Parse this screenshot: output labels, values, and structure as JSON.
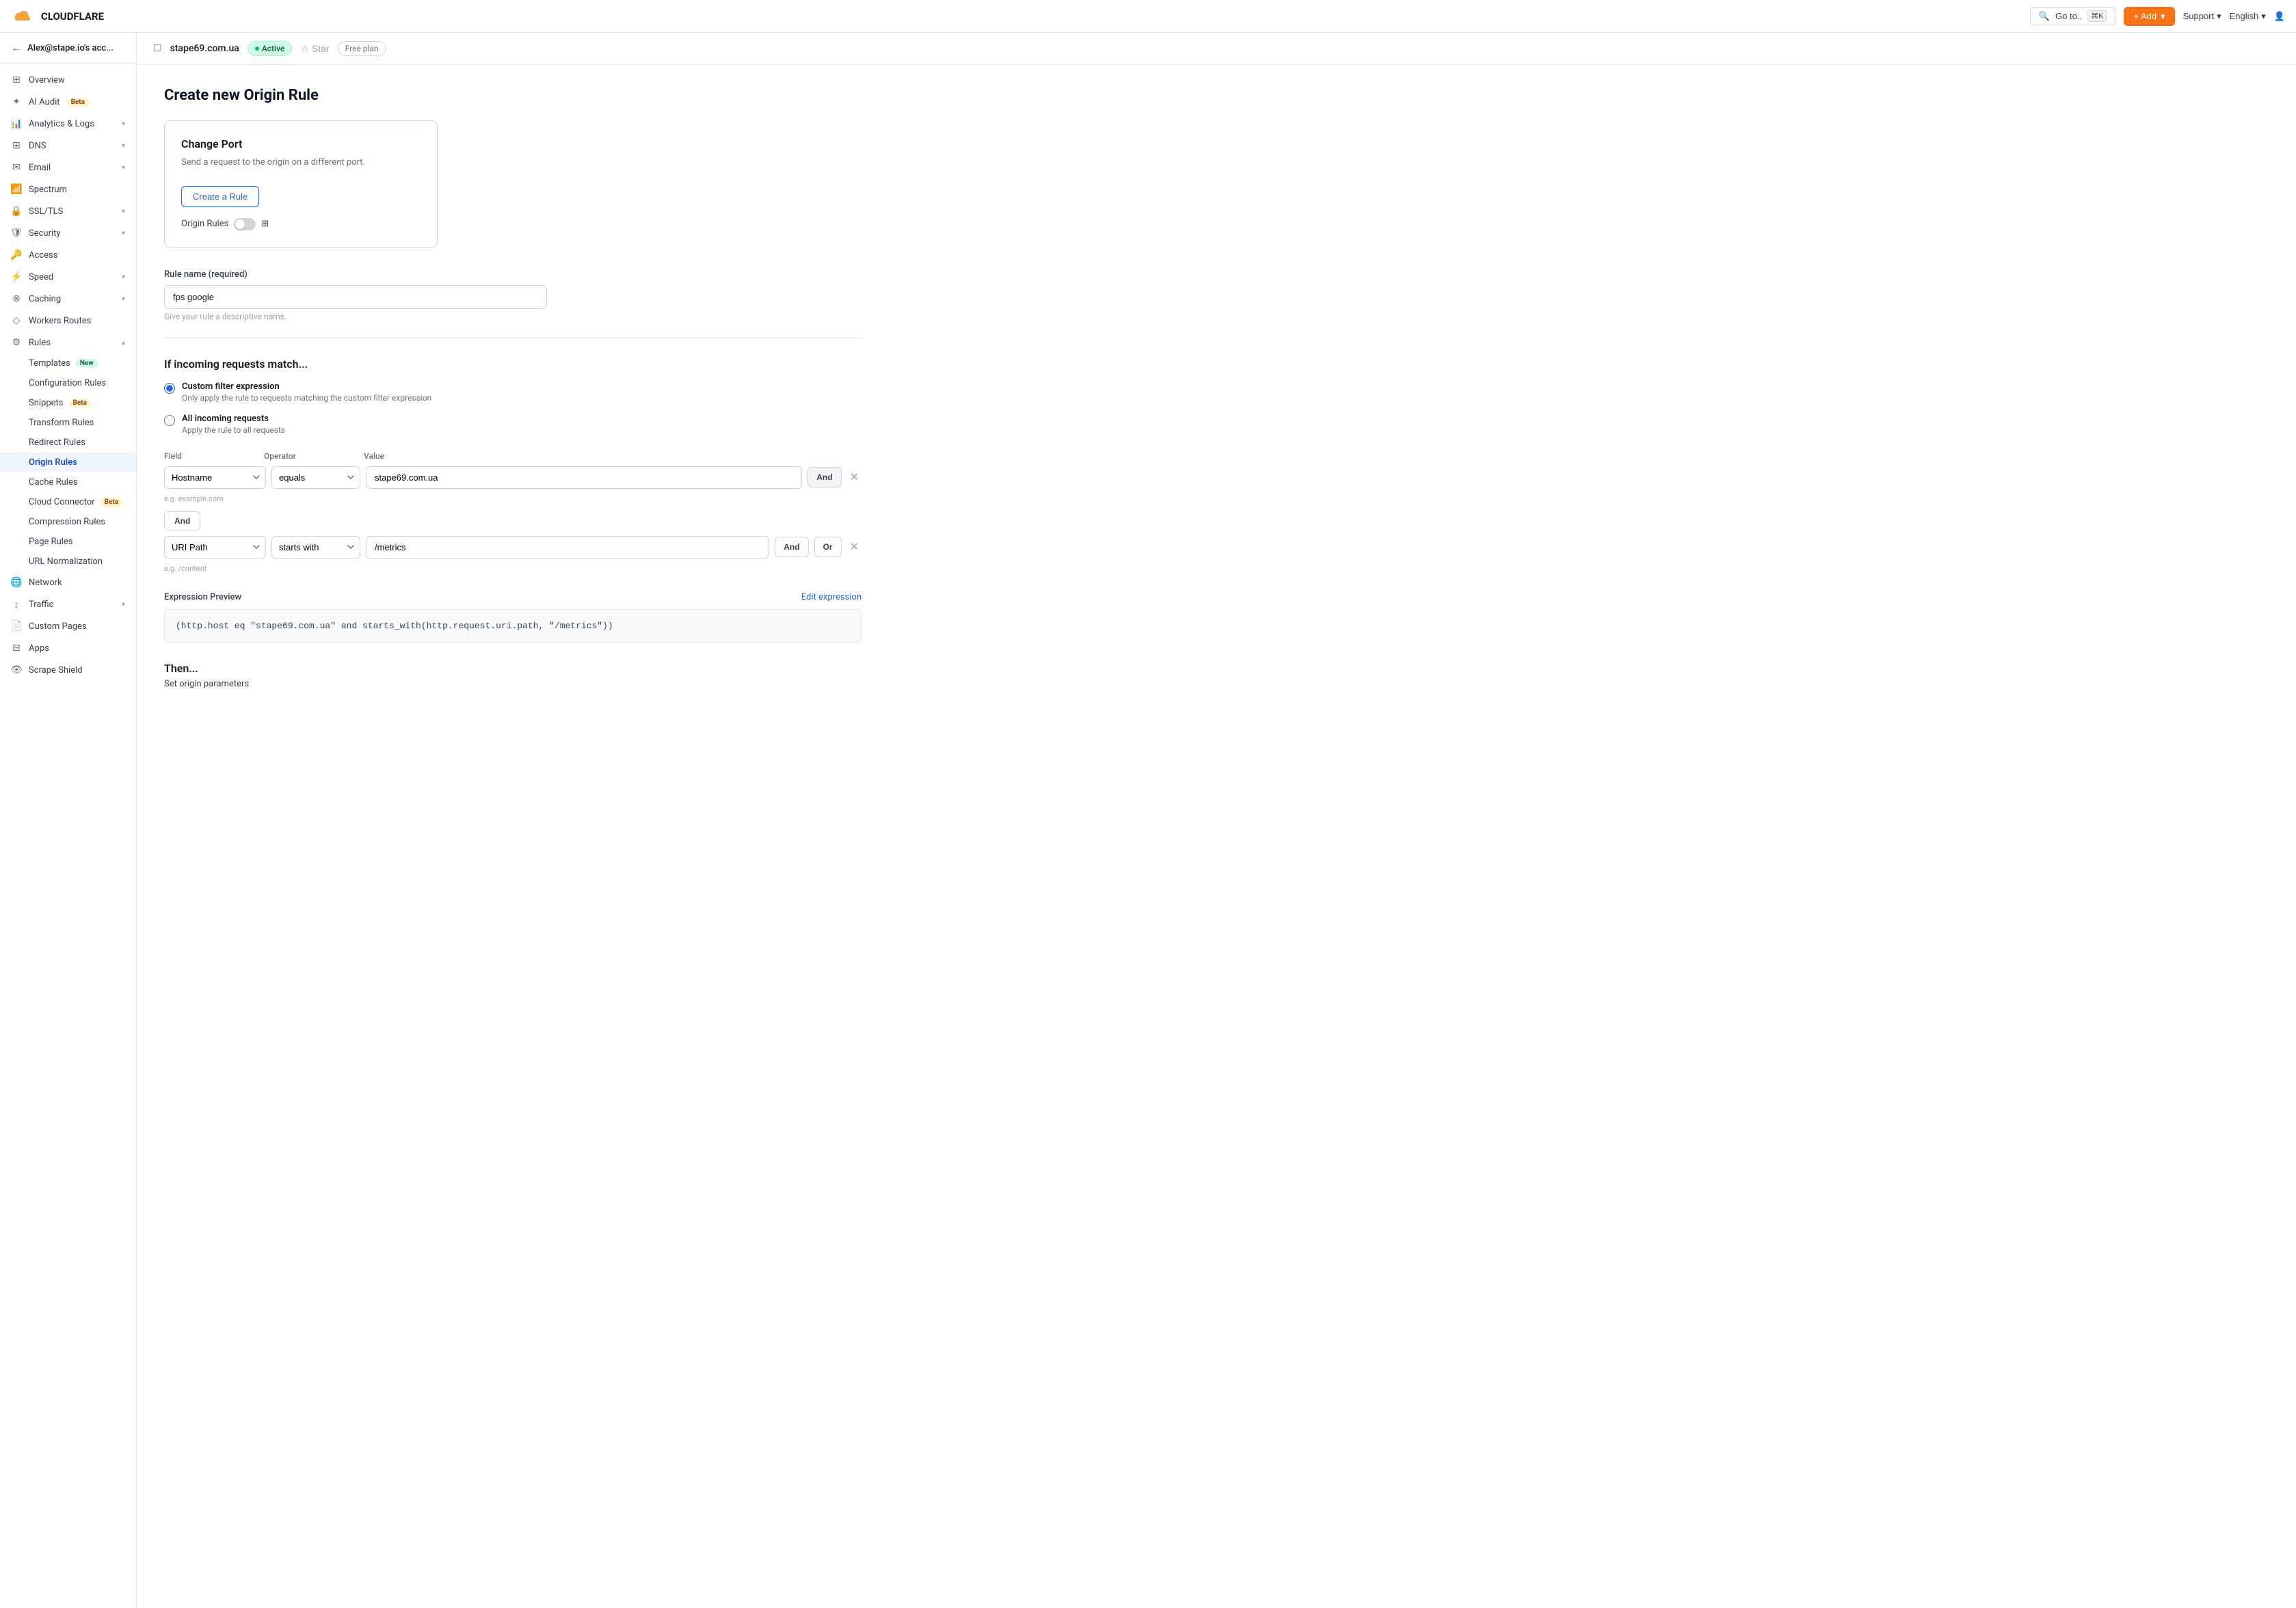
{
  "topnav": {
    "goto_label": "Go to..",
    "kbd_shortcut": "⌘K",
    "add_label": "+ Add",
    "support_label": "Support",
    "language_label": "English"
  },
  "sidebar": {
    "account": "Alex@stape.io's acc...",
    "nav_items": [
      {
        "id": "overview",
        "label": "Overview",
        "icon": "grid"
      },
      {
        "id": "ai-audit",
        "label": "AI Audit",
        "icon": "sparkle",
        "badge": "Beta",
        "badge_type": "beta"
      },
      {
        "id": "analytics-logs",
        "label": "Analytics & Logs",
        "icon": "bar-chart",
        "has_chevron": true
      },
      {
        "id": "dns",
        "label": "DNS",
        "icon": "server",
        "has_chevron": true
      },
      {
        "id": "email",
        "label": "Email",
        "icon": "mail",
        "has_chevron": true
      },
      {
        "id": "spectrum",
        "label": "Spectrum",
        "icon": "signal"
      },
      {
        "id": "ssl-tls",
        "label": "SSL/TLS",
        "icon": "lock",
        "has_chevron": true
      },
      {
        "id": "security",
        "label": "Security",
        "icon": "shield",
        "has_chevron": true
      },
      {
        "id": "access",
        "label": "Access",
        "icon": "key"
      },
      {
        "id": "speed",
        "label": "Speed",
        "icon": "lightning",
        "has_chevron": true
      },
      {
        "id": "caching",
        "label": "Caching",
        "icon": "layers",
        "has_chevron": true
      },
      {
        "id": "workers-routes",
        "label": "Workers Routes",
        "icon": "diamond"
      },
      {
        "id": "rules",
        "label": "Rules",
        "icon": "filter",
        "has_chevron": true,
        "expanded": true
      }
    ],
    "sub_items": [
      {
        "id": "templates",
        "label": "Templates",
        "badge": "New",
        "badge_type": "new"
      },
      {
        "id": "configuration-rules",
        "label": "Configuration Rules"
      },
      {
        "id": "snippets",
        "label": "Snippets",
        "badge": "Beta",
        "badge_type": "beta"
      },
      {
        "id": "transform-rules",
        "label": "Transform Rules"
      },
      {
        "id": "redirect-rules",
        "label": "Redirect Rules"
      },
      {
        "id": "origin-rules",
        "label": "Origin Rules",
        "active": true
      },
      {
        "id": "cache-rules",
        "label": "Cache Rules"
      },
      {
        "id": "cloud-connector",
        "label": "Cloud Connector",
        "badge": "Beta",
        "badge_type": "beta"
      },
      {
        "id": "compression-rules",
        "label": "Compression Rules"
      },
      {
        "id": "page-rules",
        "label": "Page Rules"
      },
      {
        "id": "url-normalization",
        "label": "URL Normalization"
      }
    ],
    "bottom_items": [
      {
        "id": "network",
        "label": "Network",
        "icon": "globe"
      },
      {
        "id": "traffic",
        "label": "Traffic",
        "icon": "traffic",
        "has_chevron": true
      },
      {
        "id": "custom-pages",
        "label": "Custom Pages",
        "icon": "file"
      },
      {
        "id": "apps",
        "label": "Apps",
        "icon": "apps"
      },
      {
        "id": "scrape-shield",
        "label": "Scrape Shield",
        "icon": "eye"
      }
    ]
  },
  "domain_bar": {
    "domain": "stape69.com.ua",
    "status": "Active",
    "star_label": "Star",
    "plan": "Free plan"
  },
  "page": {
    "title": "Create new Origin Rule",
    "rule_card": {
      "title": "Change Port",
      "description": "Send a request to the origin on a different port.",
      "create_btn": "Create a Rule",
      "origin_rules_label": "Origin Rules"
    },
    "form": {
      "rule_name_label": "Rule name (required)",
      "rule_name_value": "fps google",
      "rule_name_hint": "Give your rule a descriptive name.",
      "match_heading": "If incoming requests match...",
      "radio_custom_label": "Custom filter expression",
      "radio_custom_desc": "Only apply the rule to requests matching the custom filter expression",
      "radio_all_label": "All incoming requests",
      "radio_all_desc": "Apply the rule to all requests"
    },
    "filter": {
      "field_label": "Field",
      "operator_label": "Operator",
      "value_label": "Value",
      "rows": [
        {
          "field": "Hostname",
          "operator": "equals",
          "value": "stape69.com.ua",
          "hint": "e.g. example.com",
          "conjunction": "And"
        },
        {
          "field": "URI Path",
          "operator": "starts with",
          "value": "/metrics",
          "hint": "e.g. /content",
          "conjunction_and": "And",
          "conjunction_or": "Or"
        }
      ],
      "add_and_label": "And"
    },
    "expression_preview": {
      "label": "Expression Preview",
      "edit_link": "Edit expression",
      "code": "(http.host eq \"stape69.com.ua\" and starts_with(http.request.uri.path, \"/metrics\"))"
    },
    "then_section": {
      "title": "Then...",
      "description": "Set origin parameters"
    }
  }
}
